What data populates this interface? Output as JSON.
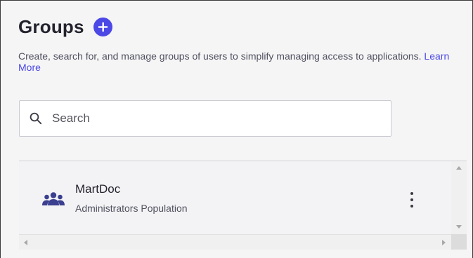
{
  "header": {
    "title": "Groups",
    "add_icon": "plus-circle-icon"
  },
  "description": {
    "text": "Create, search for, and manage groups of users to simplify managing access to applications.",
    "link": "Learn More"
  },
  "search": {
    "placeholder": "Search",
    "value": "",
    "icon": "search-icon"
  },
  "groups": [
    {
      "name": "MartDoc",
      "population": "Administrators Population",
      "icon": "group-icon",
      "menu_icon": "kebab-menu-icon"
    }
  ],
  "colors": {
    "accent": "#4b48e6",
    "title": "#23232e",
    "subtext": "#515160",
    "background": "#f5f5f6"
  }
}
